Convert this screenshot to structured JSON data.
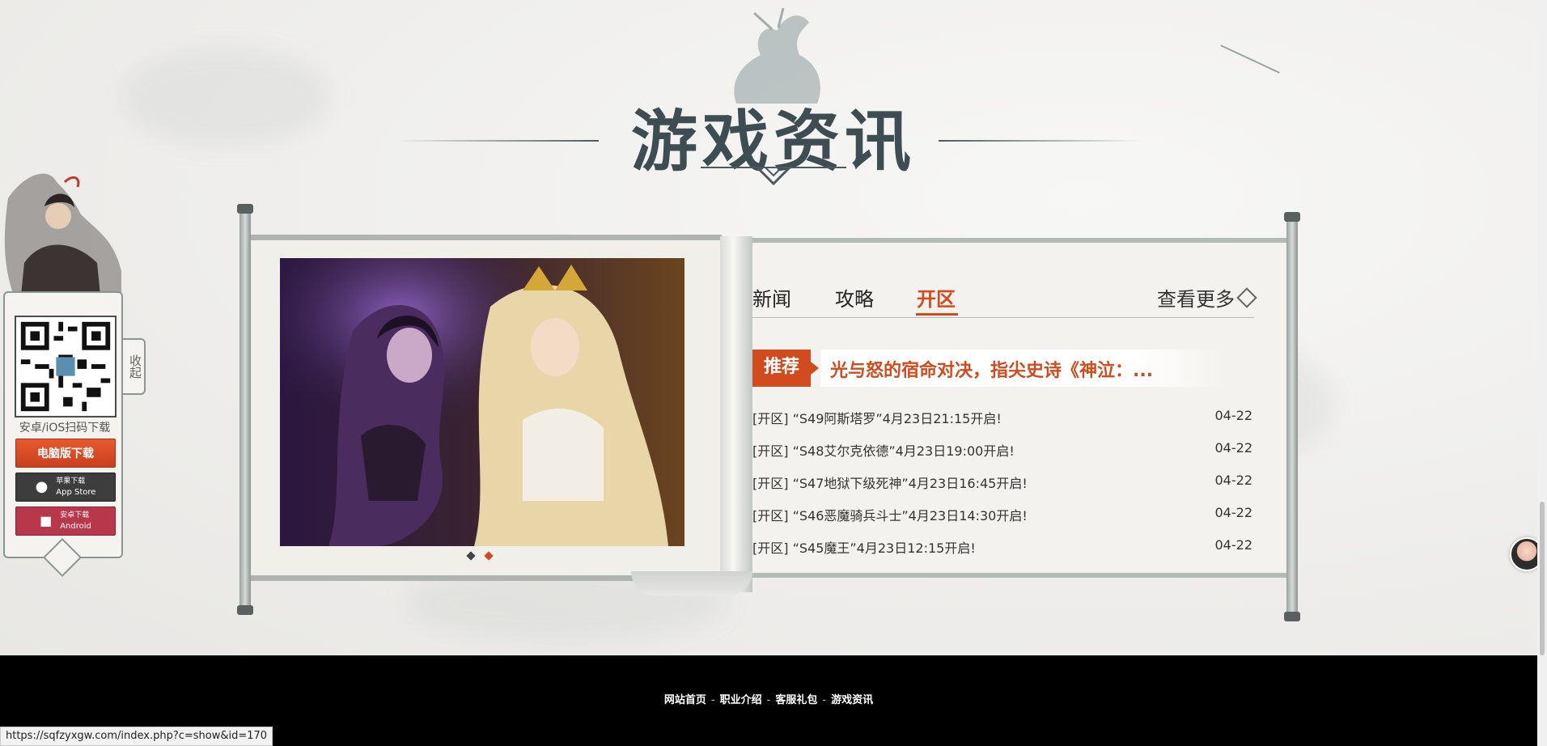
{
  "section": {
    "title": "游戏资讯"
  },
  "sidebar": {
    "scan_text": "安卓/iOS扫码下载",
    "pc_download": "电脑版下载",
    "ios_download": {
      "line1": "苹果下载",
      "line2": "App Store"
    },
    "android_download": {
      "line1": "安卓下载",
      "line2": "Android"
    },
    "collapse": "收起"
  },
  "news": {
    "tabs": [
      {
        "label": "新闻",
        "active": false
      },
      {
        "label": "攻略",
        "active": false
      },
      {
        "label": "开区",
        "active": true
      }
    ],
    "more": "查看更多",
    "featured": {
      "badge": "推荐",
      "title": "光与怒的宿命对决，指尖史诗《神泣：..."
    },
    "items": [
      {
        "title": "[开区] “S49阿斯塔罗”4月23日21:15开启!",
        "date": "04-22"
      },
      {
        "title": "[开区] “S48艾尔克依德”4月23日19:00开启!",
        "date": "04-22"
      },
      {
        "title": "[开区] “S47地狱下级死神”4月23日16:45开启!",
        "date": "04-22"
      },
      {
        "title": "[开区] “S46恶魔骑兵斗士”4月23日14:30开启!",
        "date": "04-22"
      },
      {
        "title": "[开区] “S45魔王”4月23日12:15开启!",
        "date": "04-22"
      }
    ]
  },
  "carousel": {
    "slide_count": 2,
    "active_index": 1
  },
  "footer": {
    "links": [
      "网站首页",
      "职业介绍",
      "客服礼包",
      "游戏资讯"
    ],
    "separator": "-"
  },
  "statusbar": {
    "url": "https://sqfzyxgw.com/index.php?c=show&id=170"
  },
  "colors": {
    "accent": "#d04b1e",
    "title": "#3e4d52",
    "footer": "#000000"
  }
}
